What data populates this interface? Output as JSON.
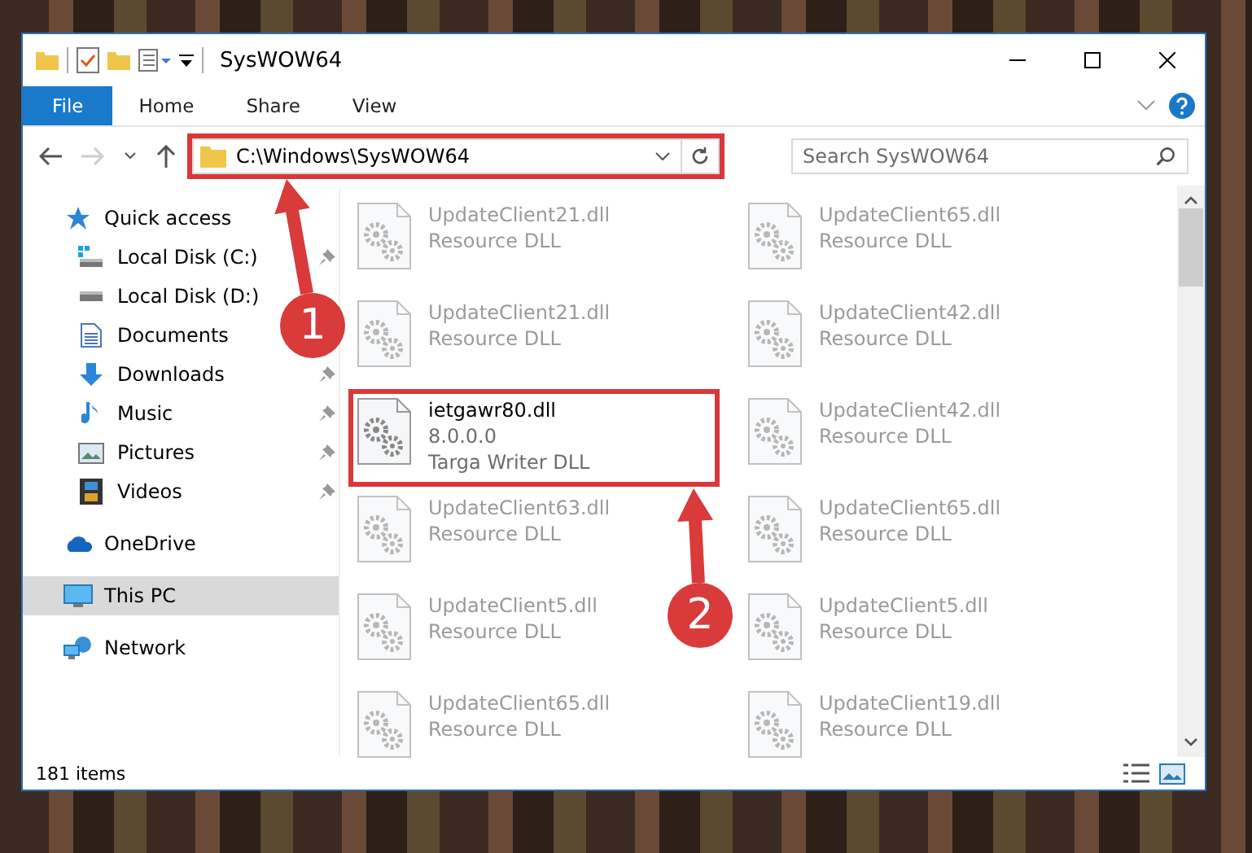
{
  "window": {
    "title": "SysWOW64"
  },
  "ribbon": {
    "tabs": [
      {
        "label": "File",
        "selected": true
      },
      {
        "label": "Home",
        "selected": false
      },
      {
        "label": "Share",
        "selected": false
      },
      {
        "label": "View",
        "selected": false
      }
    ]
  },
  "address_bar": {
    "path": "C:\\Windows\\SysWOW64",
    "highlighted": true
  },
  "search": {
    "placeholder": "Search SysWOW64"
  },
  "sidebar": {
    "items": [
      {
        "label": "Quick access",
        "selected": false,
        "children": [
          {
            "label": "Local Disk (C:)",
            "pinned": true,
            "selected": false
          },
          {
            "label": "Local Disk (D:)",
            "selected": false
          },
          {
            "label": "Documents",
            "selected": false
          },
          {
            "label": "Downloads",
            "pinned": true,
            "selected": false
          },
          {
            "label": "Music",
            "pinned": true,
            "selected": false
          },
          {
            "label": "Pictures",
            "pinned": true,
            "selected": false
          },
          {
            "label": "Videos",
            "pinned": true,
            "selected": false
          }
        ]
      },
      {
        "label": "OneDrive",
        "selected": false
      },
      {
        "label": "This PC",
        "selected": true
      },
      {
        "label": "Network",
        "selected": false
      }
    ]
  },
  "files": [
    {
      "name": "UpdateClient21.dll",
      "details": [
        "Resource DLL"
      ],
      "blurred": true,
      "highlighted": false
    },
    {
      "name": "UpdateClient65.dll",
      "details": [
        "Resource DLL"
      ],
      "blurred": true,
      "highlighted": false
    },
    {
      "name": "UpdateClient21.dll",
      "details": [
        "Resource DLL"
      ],
      "blurred": true,
      "highlighted": false
    },
    {
      "name": "UpdateClient42.dll",
      "details": [
        "Resource DLL"
      ],
      "blurred": true,
      "highlighted": false
    },
    {
      "name": "ietgawr80.dll",
      "details": [
        "8.0.0.0",
        "Targa Writer DLL"
      ],
      "blurred": false,
      "highlighted": true
    },
    {
      "name": "UpdateClient42.dll",
      "details": [
        "Resource DLL"
      ],
      "blurred": true,
      "highlighted": false
    },
    {
      "name": "UpdateClient63.dll",
      "details": [
        "Resource DLL"
      ],
      "blurred": true,
      "highlighted": false
    },
    {
      "name": "UpdateClient65.dll",
      "details": [
        "Resource DLL"
      ],
      "blurred": true,
      "highlighted": false
    },
    {
      "name": "UpdateClient5.dll",
      "details": [
        "Resource DLL"
      ],
      "blurred": true,
      "highlighted": false
    },
    {
      "name": "UpdateClient5.dll",
      "details": [
        "Resource DLL"
      ],
      "blurred": true,
      "highlighted": false
    },
    {
      "name": "UpdateClient65.dll",
      "details": [
        "Resource DLL"
      ],
      "blurred": true,
      "highlighted": false
    },
    {
      "name": "UpdateClient19.dll",
      "details": [
        "Resource DLL"
      ],
      "blurred": true,
      "highlighted": false
    }
  ],
  "status_bar": {
    "item_count": "181 items"
  },
  "annotations": [
    {
      "number": "1"
    },
    {
      "number": "2"
    }
  ]
}
